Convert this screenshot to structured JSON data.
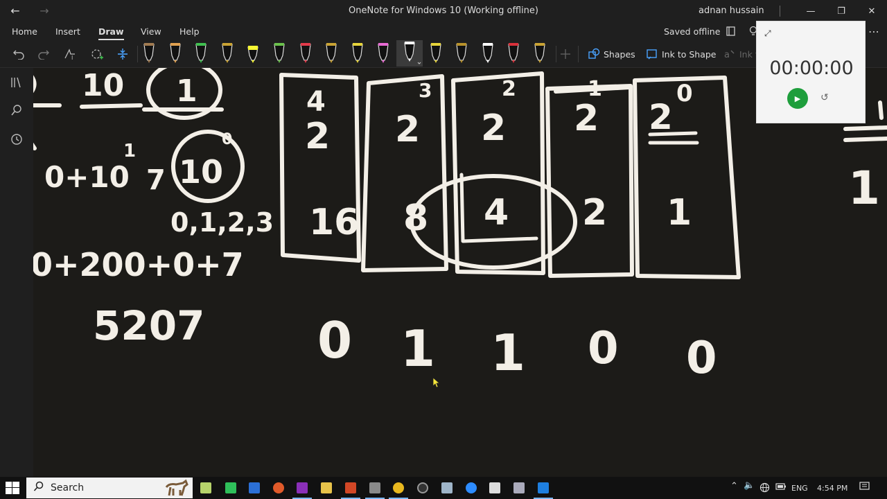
{
  "titlebar": {
    "title": "OneNote for Windows 10 (Working offline)",
    "user": "adnan hussain",
    "back_icon": "←",
    "forward_icon": "→",
    "minimize": "—",
    "maximize": "❐",
    "close": "✕"
  },
  "menu": {
    "tabs": [
      "Home",
      "Insert",
      "Draw",
      "View",
      "Help"
    ],
    "active_tab": "Draw",
    "status": "Saved offline",
    "more": "⋯"
  },
  "toolbar": {
    "shapes_label": "Shapes",
    "ink_to_shape_label": "Ink to Shape",
    "ink_to_text_label": "Ink t",
    "pens": [
      {
        "name": "pen-brown",
        "color": "#a07a50"
      },
      {
        "name": "pen-multicolor",
        "color": "#e0a050"
      },
      {
        "name": "pen-green",
        "color": "#3fbf4f"
      },
      {
        "name": "pen-gold",
        "color": "#c9a233"
      },
      {
        "name": "highlighter-yellow",
        "color": "#f7f733"
      },
      {
        "name": "pen-green-light",
        "color": "#6ac04b"
      },
      {
        "name": "pen-red",
        "color": "#e23a4a"
      },
      {
        "name": "pen-gold-2",
        "color": "#c9a233"
      },
      {
        "name": "pen-yellow",
        "color": "#e6d43a"
      },
      {
        "name": "pen-pink",
        "color": "#e86ad3"
      },
      {
        "name": "pen-white-selected",
        "color": "#ffffff"
      },
      {
        "name": "pen-yellow-2",
        "color": "#e6d43a"
      },
      {
        "name": "pen-gold-3",
        "color": "#b8912a"
      },
      {
        "name": "pen-white",
        "color": "#ffffff"
      },
      {
        "name": "pen-red-2",
        "color": "#d8303a"
      },
      {
        "name": "pen-gold-4",
        "color": "#c9a233"
      }
    ]
  },
  "timer": {
    "time": "00:00:00",
    "play": "▶",
    "reset": "↺",
    "expand": "⤢"
  },
  "canvas": {
    "ink_text": {
      "ten": "10",
      "one_circled": "1",
      "zero_plus": "0+10",
      "exp_one": "1",
      "seven": "7",
      "ten_circled": "10",
      "exp_zero_small": "0",
      "sequence": "0,1,2,3",
      "sum": "0+200+0+7",
      "result": "5207",
      "box1_top": "4",
      "box1_mid": "2",
      "box1_bot": "16",
      "box2_top": "3",
      "box2_mid": "2",
      "box2_bot": "8",
      "box3_top": "2",
      "box3_mid": "2",
      "box3_bot": "4",
      "box4_top": "1",
      "box4_mid": "2",
      "box4_bot": "2",
      "box5_top": "0",
      "box5_mid": "2",
      "box5_bot": "1",
      "bits": [
        "0",
        "1",
        "1",
        "0",
        "0"
      ],
      "right_edge": "1"
    }
  },
  "taskbar": {
    "search_placeholder": "Search",
    "lang": "ENG",
    "time": "4:54 PM"
  }
}
